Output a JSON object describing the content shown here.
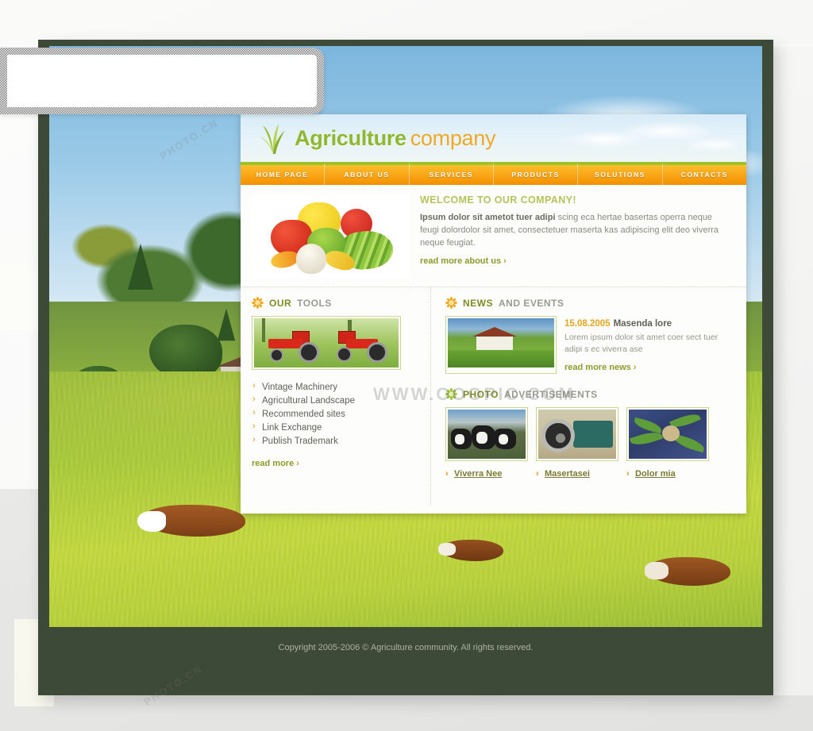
{
  "site": {
    "logo": {
      "icon": "grass-icon",
      "main": "Agriculture",
      "sub": "company"
    },
    "nav": [
      {
        "label": "HOME PAGE"
      },
      {
        "label": "ABOUT US"
      },
      {
        "label": "SERVICES"
      },
      {
        "label": "PRODUCTS"
      },
      {
        "label": "SOLUTIONS"
      },
      {
        "label": "CONTACTS"
      }
    ]
  },
  "welcome": {
    "image_alt": "vegetables-photo",
    "title": "WELCOME TO OUR COMPANY!",
    "lead": "Ipsum dolor sit ametot tuer adipi",
    "body": " scing eca hertae basertas operra neque feugi dolordolor sit amet, consectetuer maserta kas adipiscing elit deo viverra neque feugiat.",
    "read_more": "read more about us",
    "arrow": "›"
  },
  "tools": {
    "heading_1": "OUR",
    "heading_2": "TOOLS",
    "icon": "orange-flower-icon",
    "image_alt": "red-tractors-photo",
    "items": [
      {
        "label": "Vintage Machinery"
      },
      {
        "label": "Agricultural Landscape"
      },
      {
        "label": "Recommended sites"
      },
      {
        "label": "Link Exchange"
      },
      {
        "label": "Publish Trademark"
      }
    ],
    "read_more": "read more",
    "arrow": "›"
  },
  "news": {
    "heading_1": "NEWS",
    "heading_2": "AND EVENTS",
    "icon": "orange-flower-icon",
    "image_alt": "farmhouse-photo",
    "date": "15.08.2005",
    "title": "Masenda lore",
    "body": "Lorem ipsum dolor sit amet coer sect tuer adipi s ec viverra ase",
    "read_more": "read more news",
    "arrow": "›"
  },
  "photo_ads": {
    "heading_1": "PHOTO",
    "heading_2": "ADVERTISEMENTS",
    "icon": "green-flower-icon",
    "items": [
      {
        "label": "Viverra Nee",
        "image_alt": "cows-photo"
      },
      {
        "label": "Masertasei",
        "image_alt": "tractor-wheel-photo"
      },
      {
        "label": "Dolor mia",
        "image_alt": "plant-leaves-photo"
      }
    ]
  },
  "footer": {
    "copyright": "Copyright 2005-2006 © Agriculture community. All rights reserved."
  },
  "watermarks": {
    "url": "WWW.OOOPIC.COM",
    "cn": "PHOTO.CN"
  },
  "colors": {
    "nav_orange": "#f9a61a",
    "nav_top_green": "#9cc22c",
    "logo_green": "#8fb82e",
    "logo_orange": "#f0a826",
    "frame_dark_green": "#3e4a38",
    "heading_olive": "#7f8c24",
    "date_orange": "#e8a520",
    "link_olive": "#8d9b2c"
  }
}
